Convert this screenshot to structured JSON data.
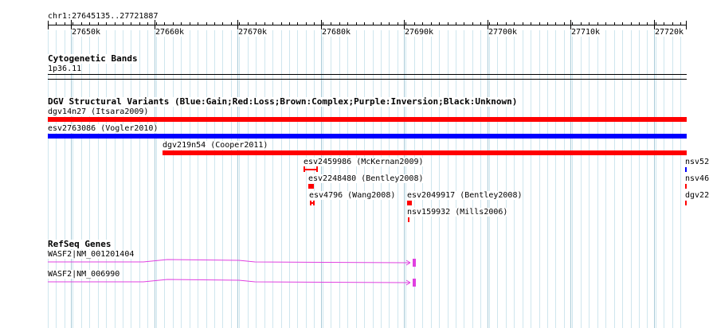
{
  "locus": "chr1:27645135..27721887",
  "ruler": {
    "ticks": [
      "27650k",
      "27660k",
      "27670k",
      "27680k",
      "27690k",
      "27700k",
      "27710k",
      "27720k"
    ]
  },
  "cytoband": {
    "title": "Cytogenetic Bands",
    "band": "1p36.11"
  },
  "dgv": {
    "title": "DGV Structural Variants (Blue:Gain;Red:Loss;Brown:Complex;Purple:Inversion;Black:Unknown)",
    "features": [
      {
        "label": "dgv14n27 (Itsara2009)",
        "color": "#ff0000"
      },
      {
        "label": "esv2763086 (Vogler2010)",
        "color": "#0000ff"
      },
      {
        "label": "dgv219n54 (Cooper2011)",
        "color": "#ff0000"
      },
      {
        "label": "esv2459986 (McKernan2009)",
        "color": "#ff0000"
      },
      {
        "label": "esv2248480 (Bentley2008)",
        "color": "#ff0000"
      },
      {
        "label": "esv4796 (Wang2008)",
        "color": "#ff0000"
      },
      {
        "label": "esv2049917 (Bentley2008)",
        "color": "#ff0000"
      },
      {
        "label": "nsv159932 (Mills2006)",
        "color": "#ff0000"
      },
      {
        "label": "nsv52",
        "color": "#0000ff"
      },
      {
        "label": "nsv46",
        "color": "#ff0000"
      },
      {
        "label": "dgv22",
        "color": "#ff0000"
      }
    ]
  },
  "refseq": {
    "title": "RefSeq Genes",
    "genes": [
      {
        "label": "WASF2|NM_001201404",
        "color": "#e040e0"
      },
      {
        "label": "WASF2|NM_006990",
        "color": "#e040e0"
      }
    ]
  }
}
